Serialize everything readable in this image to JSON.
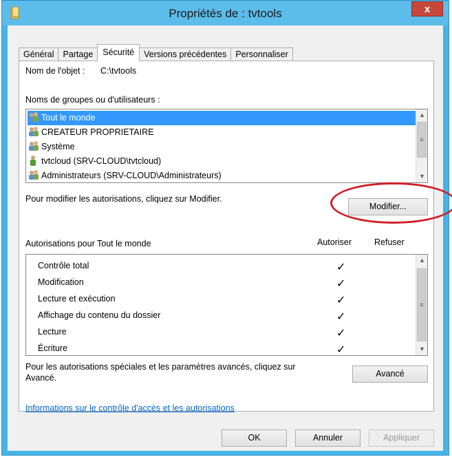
{
  "window": {
    "title": "Propriétés de : tvtools",
    "close_label": "x",
    "title_bar_color": "#5cbcea",
    "frame_color": "#47b3e7"
  },
  "tabs": [
    {
      "label": "Général",
      "active": false
    },
    {
      "label": "Partage",
      "active": false
    },
    {
      "label": "Sécurité",
      "active": true
    },
    {
      "label": "Versions précédentes",
      "active": false
    },
    {
      "label": "Personnaliser",
      "active": false
    }
  ],
  "object": {
    "label": "Nom de l'objet :",
    "value": "C:\\tvtools"
  },
  "groups": {
    "label": "Noms de groupes ou d'utilisateurs :",
    "items": [
      {
        "label": "Tout le monde",
        "icon": "users-group-icon",
        "selected": true
      },
      {
        "label": "CREATEUR PROPRIETAIRE",
        "icon": "users-group-icon",
        "selected": false
      },
      {
        "label": "Système",
        "icon": "users-group-icon",
        "selected": false
      },
      {
        "label": "tvtcloud (SRV-CLOUD\\tvtcloud)",
        "icon": "user-icon",
        "selected": false
      },
      {
        "label": "Administrateurs (SRV-CLOUD\\Administrateurs)",
        "icon": "users-group-icon",
        "selected": false
      }
    ],
    "selection_color": "#3399ff"
  },
  "modify": {
    "hint": "Pour modifier les autorisations, cliquez sur Modifier.",
    "button_label": "Modifier...",
    "highlight_color": "#d11f26"
  },
  "permissions": {
    "label": "Autorisations pour Tout le monde",
    "allow_header": "Autoriser",
    "deny_header": "Refuser",
    "check_glyph": "✓",
    "rows": [
      {
        "label": "Contrôle total",
        "allow": true,
        "deny": false
      },
      {
        "label": "Modification",
        "allow": true,
        "deny": false
      },
      {
        "label": "Lecture et exécution",
        "allow": true,
        "deny": false
      },
      {
        "label": "Affichage du contenu du dossier",
        "allow": true,
        "deny": false
      },
      {
        "label": "Lecture",
        "allow": true,
        "deny": false
      },
      {
        "label": "Écriture",
        "allow": true,
        "deny": false
      }
    ]
  },
  "advanced": {
    "hint_line1": "Pour les autorisations spéciales et les paramètres avancés, cliquez sur",
    "hint_line2": "Avancé.",
    "button_label": "Avancé"
  },
  "help_link": "Informations sur le contrôle d'accès et les autorisations",
  "footer": {
    "ok_label": "OK",
    "cancel_label": "Annuler",
    "apply_label": "Appliquer"
  }
}
